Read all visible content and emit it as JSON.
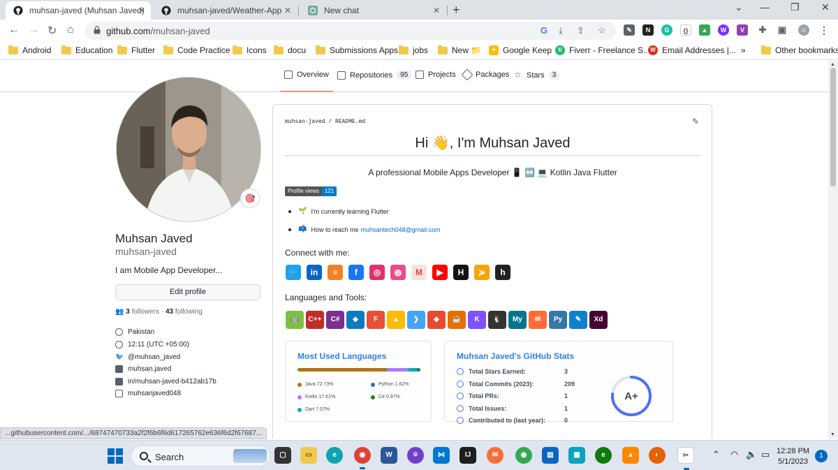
{
  "tabs": [
    {
      "title": "muhsan-javed (Muhsan Javed)",
      "active": true
    },
    {
      "title": "muhsan-javed/Weather-App: Thi",
      "active": false
    },
    {
      "title": "New chat",
      "active": false
    }
  ],
  "omnibox": {
    "domain": "github.com",
    "path": "/muhsan-javed"
  },
  "bookmarks": [
    "Android",
    "Education",
    "Flutter",
    "Code Practice",
    "Icons",
    "docu",
    "Submissions Apps",
    "jobs",
    "New 📁",
    "Google Keep",
    "Fiverr - Freelance S...",
    "Email Addresses |...",
    "»",
    "Other bookmarks"
  ],
  "profile_nav": [
    {
      "label": "Overview",
      "count": ""
    },
    {
      "label": "Repositories",
      "count": "95"
    },
    {
      "label": "Projects",
      "count": ""
    },
    {
      "label": "Packages",
      "count": ""
    },
    {
      "label": "Stars",
      "count": "3"
    }
  ],
  "profile": {
    "status_emoji": "🎯",
    "name": "Muhsan Javed",
    "login": "muhsan-javed",
    "bio": "I am Mobile App Developer...",
    "edit_label": "Edit profile",
    "followers": "3",
    "followers_label": "followers",
    "separator": " · ",
    "following": "43",
    "following_label": "following",
    "location": "Pakistan",
    "local_time": "12:11 (UTC +05:00)",
    "twitter": "@muhsan_javed",
    "facebook": "muhsan.javed",
    "linkedin": "in/muhsan-javed-b412ab17b",
    "other": "muhsanjaved048"
  },
  "readme": {
    "path": "muhsan-javed / README.md",
    "title": "Hi 👋, I'm Muhsan Javed",
    "subtitle": "A professional Mobile Apps Developer 📱 ↔️ 💻 Kotlin Java Flutter",
    "badge_label": "Profile views",
    "badge_value": "121",
    "learning_emoji": "🌱",
    "learning_text": "I'm currently learning",
    "learning_value": "Flutter",
    "reach_emoji": "📫",
    "reach_text": "How to reach me",
    "reach_email": "muhsantech048@gmail.com",
    "connect_heading": "Connect with me:",
    "connect_icons": [
      {
        "name": "twitter-icon",
        "glyph": "🐦",
        "color": "#1da1f2"
      },
      {
        "name": "linkedin-icon",
        "glyph": "in",
        "color": "#0a66c2"
      },
      {
        "name": "stackoverflow-icon",
        "glyph": "≡",
        "color": "#f48024"
      },
      {
        "name": "facebook-icon",
        "glyph": "f",
        "color": "#1877f2"
      },
      {
        "name": "instagram-icon",
        "glyph": "◎",
        "color": "#e1306c"
      },
      {
        "name": "dribbble-icon",
        "glyph": "◍",
        "color": "#ea4c89"
      },
      {
        "name": "medium-icon",
        "glyph": "M",
        "color": "#f7e2dc"
      },
      {
        "name": "youtube-icon",
        "glyph": "▶",
        "color": "#ff0000"
      },
      {
        "name": "hackerrank-icon",
        "glyph": "H",
        "color": "#111111"
      },
      {
        "name": "codesignal-icon",
        "glyph": "≽",
        "color": "#f7a600"
      },
      {
        "name": "hackerearth-icon",
        "glyph": "h",
        "color": "#222222"
      }
    ],
    "tools_heading": "Languages and Tools:",
    "tool_icons": [
      {
        "name": "android-icon",
        "glyph": "🤖",
        "color": "#7cc242"
      },
      {
        "name": "cplusplus-icon",
        "glyph": "C++",
        "color": "#c42c28"
      },
      {
        "name": "csharp-icon",
        "glyph": "C#",
        "color": "#7b2f91"
      },
      {
        "name": "dart-icon",
        "glyph": "◆",
        "color": "#0a7bbf"
      },
      {
        "name": "figma-icon",
        "glyph": "F",
        "color": "#e94f37"
      },
      {
        "name": "firebase-icon",
        "glyph": "▲",
        "color": "#fbbc05"
      },
      {
        "name": "flutter-icon",
        "glyph": "❯",
        "color": "#42a5f5"
      },
      {
        "name": "git-icon",
        "glyph": "◈",
        "color": "#e44c30"
      },
      {
        "name": "java-icon",
        "glyph": "☕",
        "color": "#e76f00"
      },
      {
        "name": "kotlin-icon",
        "glyph": "K",
        "color": "#7f52ff"
      },
      {
        "name": "linux-icon",
        "glyph": "🐧",
        "color": "#333333"
      },
      {
        "name": "mysql-icon",
        "glyph": "My",
        "color": "#00758f"
      },
      {
        "name": "postman-icon",
        "glyph": "✉",
        "color": "#ff6c37"
      },
      {
        "name": "python-icon",
        "glyph": "Py",
        "color": "#3776ab"
      },
      {
        "name": "sqlite-icon",
        "glyph": "✎",
        "color": "#0f80cc"
      },
      {
        "name": "xd-icon",
        "glyph": "Xd",
        "color": "#470137"
      }
    ],
    "languages_card": {
      "title": "Most Used Languages",
      "languages": [
        {
          "label": "Java 72.73%",
          "percent": 72.73,
          "color": "#b07219"
        },
        {
          "label": "Kotlin 17.61%",
          "percent": 17.61,
          "color": "#A97BFF"
        },
        {
          "label": "Dart 7.07%",
          "percent": 7.07,
          "color": "#00B4AB"
        },
        {
          "label": "Python 1.62%",
          "percent": 1.62,
          "color": "#3572A5"
        },
        {
          "label": "C# 0.97%",
          "percent": 0.97,
          "color": "#178600"
        }
      ]
    },
    "stats_card": {
      "title": "Muhsan Javed's GitHub Stats",
      "rows": [
        {
          "label": "Total Stars Earned:",
          "value": "3"
        },
        {
          "label": "Total Commits (2023):",
          "value": "209"
        },
        {
          "label": "Total PRs:",
          "value": "1"
        },
        {
          "label": "Total Issues:",
          "value": "1"
        },
        {
          "label": "Contributed to (last year):",
          "value": "0"
        }
      ],
      "grade": "A+",
      "accent": "#4c71f2"
    }
  },
  "status_url": "...githubusercontent.com/.../68747470733a2f2f6b6f6d617265762e636f6d2f67687...",
  "taskbar": {
    "search_label": "Search",
    "time": "12:28 PM",
    "date": "5/1/2023",
    "notifications": "1"
  }
}
